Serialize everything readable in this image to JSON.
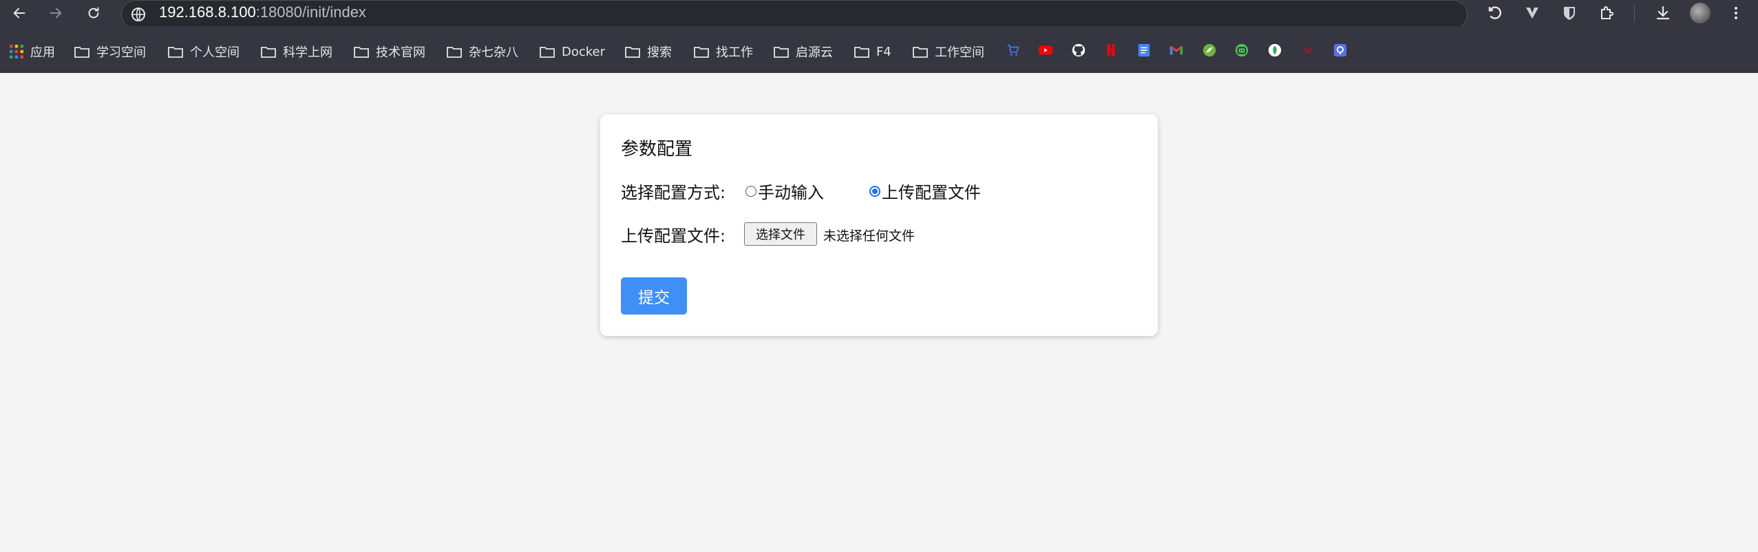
{
  "browser": {
    "url_host": "192.168.8.100",
    "url_rest": ":18080/init/index",
    "nav_icons": [
      "back-arrow-icon",
      "forward-arrow-icon",
      "reload-icon"
    ],
    "right_icons": [
      "undo-icon",
      "extension-v-icon",
      "bitwarden-icon",
      "extensions-puzzle-icon",
      "download-icon",
      "profile-avatar",
      "menu-dots-icon"
    ]
  },
  "bookmarks": {
    "apps_label": "应用",
    "folders": [
      "学习空间",
      "个人空间",
      "科学上网",
      "技术官网",
      "杂七杂八",
      "Docker",
      "搜索",
      "找工作",
      "启源云",
      "F4",
      "工作空间"
    ],
    "icons": [
      "cart-icon",
      "youtube-icon",
      "github-icon",
      "netflix-icon",
      "docs-icon",
      "gmail-icon",
      "spring-icon",
      "bilibili-icon",
      "leaf-icon",
      "huawei-icon",
      "link-icon"
    ]
  },
  "card": {
    "title": "参数配置",
    "mode_label": "选择配置方式:",
    "option_manual": "手动输入",
    "option_upload": "上传配置文件",
    "selected_option": "上传配置文件",
    "file_label": "上传配置文件:",
    "file_button": "选择文件",
    "file_status": "未选择任何文件",
    "submit_label": "提交"
  },
  "colors": {
    "chrome_bg": "#35363f",
    "page_bg": "#f4f4f4",
    "primary": "#3f8ff7",
    "radio_checked": "#1a73e8"
  }
}
